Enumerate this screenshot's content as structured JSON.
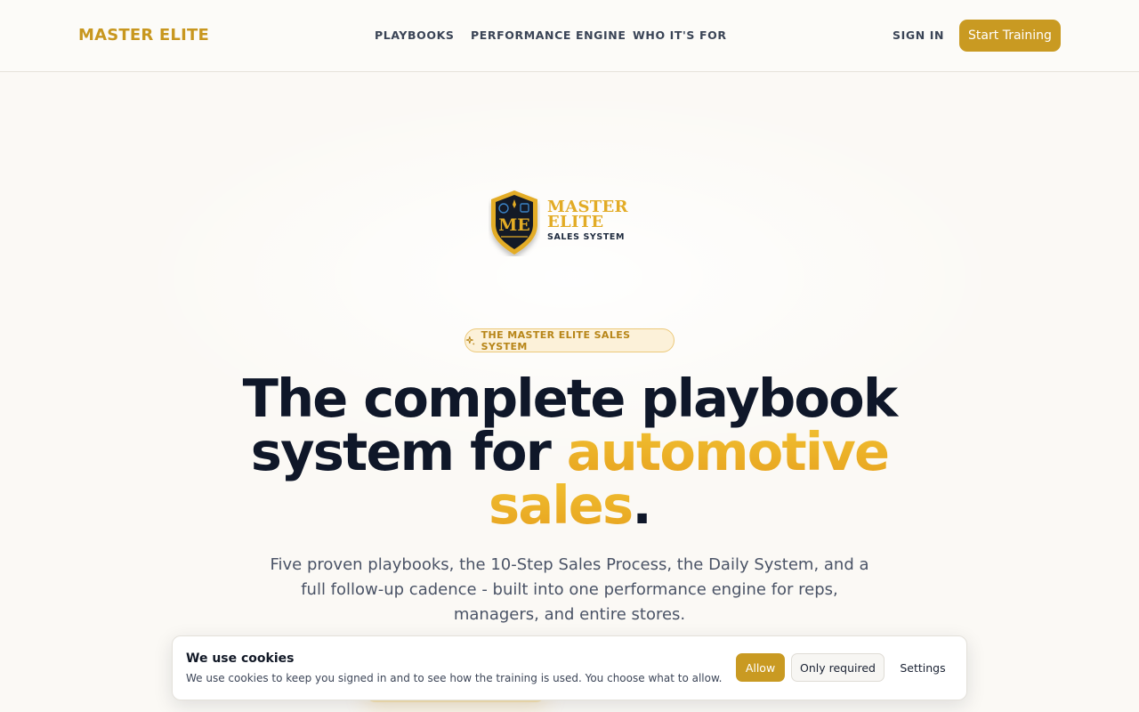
{
  "header": {
    "brand": "MASTER ELITE",
    "nav": [
      "PLAYBOOKS",
      "PERFORMANCE ENGINE",
      "WHO IT'S FOR"
    ],
    "sign_in": "SIGN IN",
    "cta": "Start Training"
  },
  "logo": {
    "title_line1": "MASTER",
    "title_line2": "ELITE",
    "subtitle": "SALES SYSTEM",
    "shield_letters": "ME"
  },
  "hero": {
    "pill": "THE MASTER ELITE SALES SYSTEM",
    "headline_line1": "The complete playbook",
    "headline_part2": "system for ",
    "headline_accent1": "automotive",
    "headline_accent2": "sales",
    "headline_period": ".",
    "subtitle": "Five proven playbooks, the 10-Step Sales Process, the Daily System, and a full follow-up cadence - built into one performance engine for reps, managers, and entire stores."
  },
  "cookie": {
    "title": "We use cookies",
    "text": "We use cookies to keep you signed in and to see how the training is used. You choose what to allow.",
    "allow": "Allow",
    "only_required": "Only required",
    "settings": "Settings"
  },
  "colors": {
    "accent": "#c99a22",
    "accent_light": "#e7a21f",
    "heading": "#0f1729",
    "background": "#fbf9f5"
  }
}
